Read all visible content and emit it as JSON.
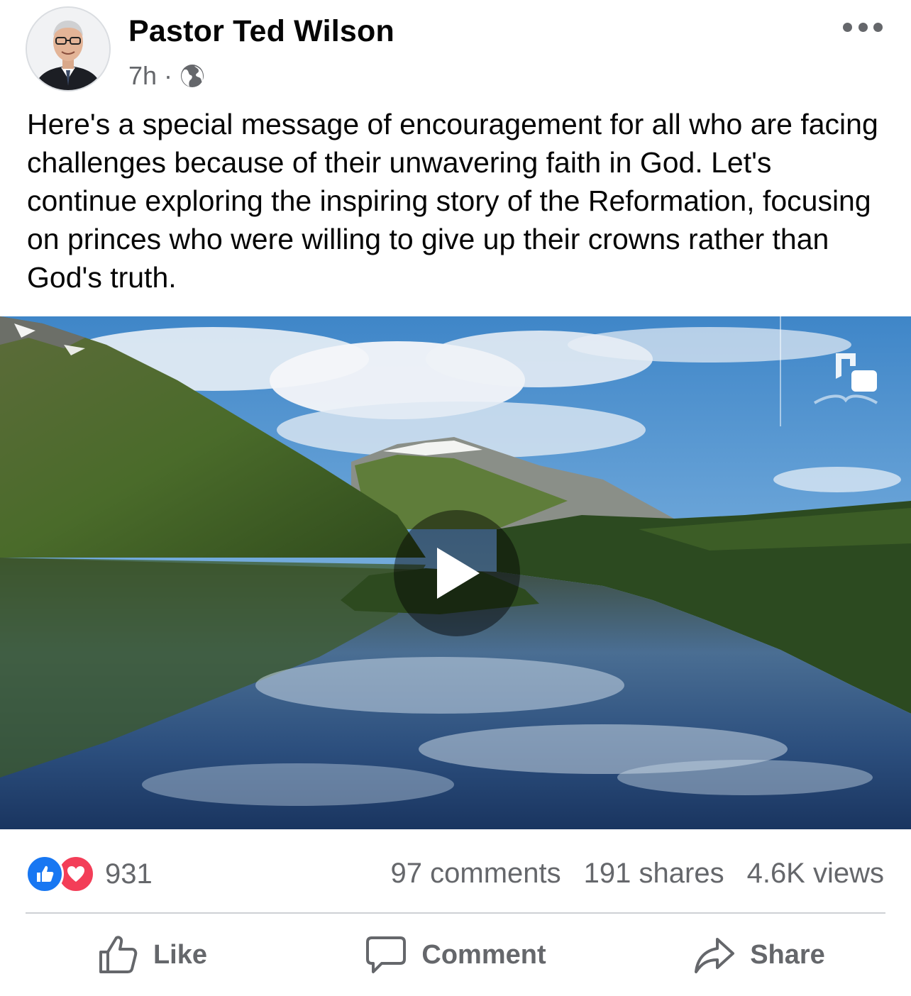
{
  "post": {
    "author": "Pastor Ted Wilson",
    "time": "7h",
    "separator": "·",
    "privacy_icon": "globe-icon",
    "more_icon": "more-options-icon",
    "text": "Here's a special message of encouragement for all who are facing challenges because of their unwavering faith in God. Let's continue exploring the inspiring story of the Reformation, focusing on princes who were willing to give up their crowns rather than God's truth."
  },
  "video": {
    "thumbnail": "fjord-landscape-thumbnail",
    "play_icon": "play-icon",
    "watermark_icon": "church-logo-icon"
  },
  "stats": {
    "reaction_icons": [
      "like-reaction-icon",
      "love-reaction-icon"
    ],
    "reactions_count": "931",
    "comments": "97 comments",
    "shares": "191 shares",
    "views": "4.6K views"
  },
  "actions": {
    "like": "Like",
    "comment": "Comment",
    "share": "Share"
  },
  "colors": {
    "like_blue": "#1877f2",
    "love_red": "#f33e58",
    "secondary_text": "#65676b",
    "divider": "#ced0d4"
  }
}
